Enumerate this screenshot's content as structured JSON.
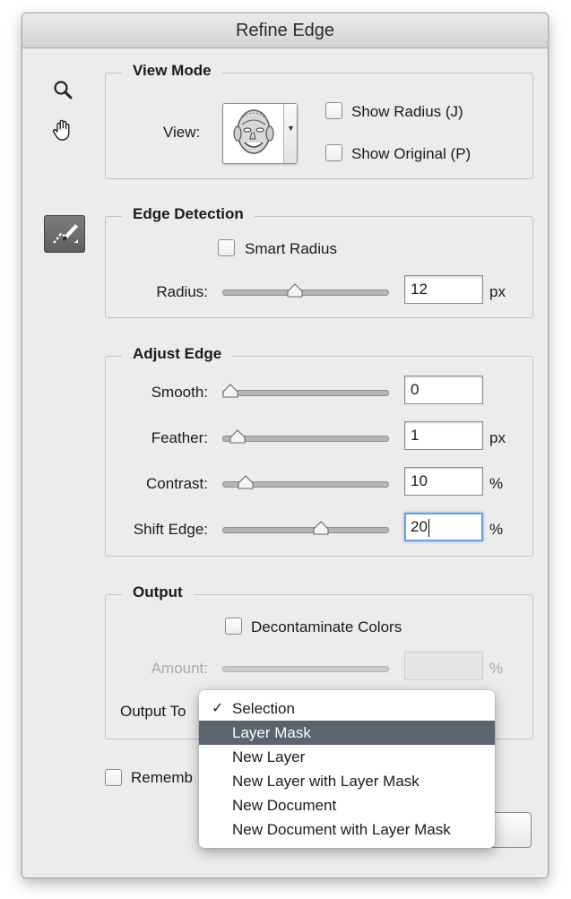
{
  "dialog": {
    "title": "Refine Edge"
  },
  "tools": {
    "zoom_icon": "magnifier",
    "hand_icon": "hand",
    "brush_icon": "refine-radius-brush"
  },
  "view_mode": {
    "legend": "View Mode",
    "view_label": "View:",
    "show_radius": {
      "label": "Show Radius (J)",
      "checked": false
    },
    "show_original": {
      "label": "Show Original (P)",
      "checked": false
    }
  },
  "edge_detection": {
    "legend": "Edge Detection",
    "smart_radius": {
      "label": "Smart Radius",
      "checked": false
    },
    "radius": {
      "label": "Radius:",
      "value": "12",
      "unit": "px",
      "slider": 0.43
    }
  },
  "adjust_edge": {
    "legend": "Adjust Edge",
    "smooth": {
      "label": "Smooth:",
      "value": "0",
      "unit": "",
      "slider": 0.0
    },
    "feather": {
      "label": "Feather:",
      "value": "1",
      "unit": "px",
      "slider": 0.05
    },
    "contrast": {
      "label": "Contrast:",
      "value": "10",
      "unit": "%",
      "slider": 0.1
    },
    "shift_edge": {
      "label": "Shift Edge:",
      "value": "20",
      "unit": "%",
      "slider": 0.6
    }
  },
  "output": {
    "legend": "Output",
    "decontaminate": {
      "label": "Decontaminate Colors",
      "checked": false
    },
    "amount": {
      "label": "Amount:",
      "value": "",
      "unit": "%"
    },
    "output_to_label": "Output To"
  },
  "remember": {
    "label": "Rememb",
    "checked": false
  },
  "output_menu": {
    "selected": "Selection",
    "highlighted": "Layer Mask",
    "items": [
      "Selection",
      "Layer Mask",
      "New Layer",
      "New Layer with Layer Mask",
      "New Document",
      "New Document with Layer Mask"
    ]
  },
  "colors": {
    "menu_highlight": "#5a6570",
    "focus_ring": "#6a9fe6",
    "dialog_bg": "#ececec"
  }
}
